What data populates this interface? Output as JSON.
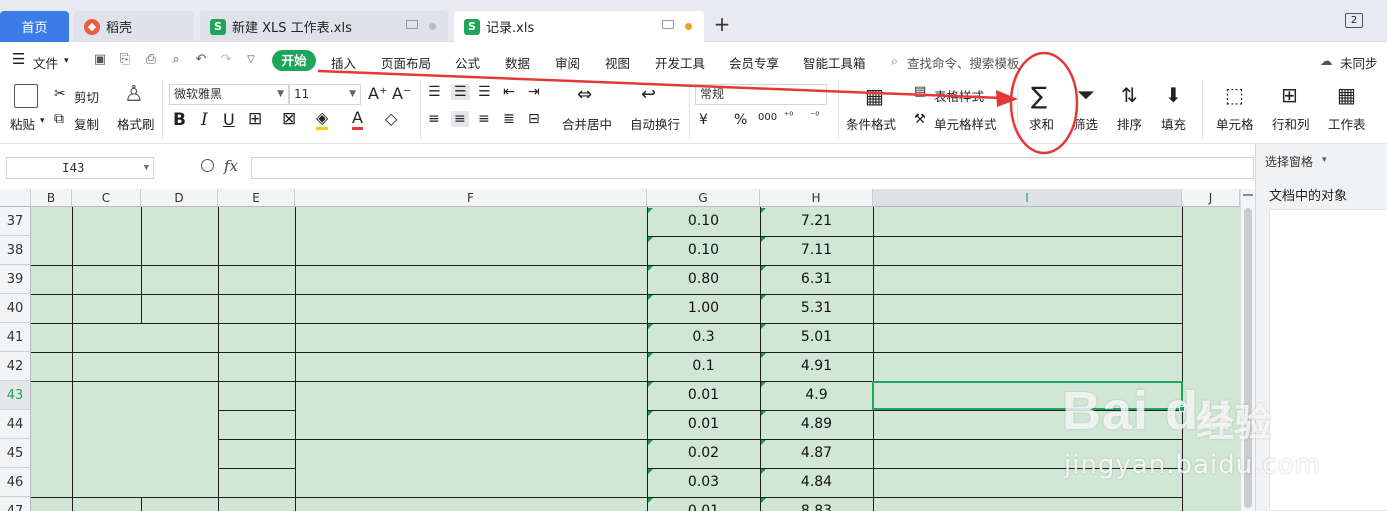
{
  "tabs": {
    "home": "首页",
    "daoke": "稻壳",
    "new_sheet": "新建 XLS 工作表.xls",
    "record": "记录.xls",
    "add": "+",
    "window_count": "2"
  },
  "menu": {
    "file": "文件",
    "start": "开始",
    "insert": "插入",
    "page_layout": "页面布局",
    "formula": "公式",
    "data": "数据",
    "review": "审阅",
    "view": "视图",
    "developer": "开发工具",
    "member": "会员专享",
    "smart_toolbox": "智能工具箱",
    "search": "查找命令、搜索模板",
    "sync": "未同步"
  },
  "ribbon": {
    "paste": "粘贴",
    "cut": "剪切",
    "copy": "复制",
    "format_painter": "格式刷",
    "font_name": "微软雅黑",
    "font_size": "11",
    "merge_center": "合并居中",
    "wrap_text": "自动换行",
    "number_format": "常规",
    "currency": "¥",
    "percent": "%",
    "thousands": "000",
    "cond_format": "条件格式",
    "table_style": "表格样式",
    "cell_style": "单元格样式",
    "sum": "求和",
    "filter": "筛选",
    "sort": "排序",
    "fill": "填充",
    "cell": "单元格",
    "row_col": "行和列",
    "worksheet": "工作表"
  },
  "formula_bar": {
    "name_box": "I43",
    "fx": "fx",
    "content": ""
  },
  "columns": [
    "B",
    "C",
    "D",
    "E",
    "F",
    "G",
    "H",
    "I",
    "J"
  ],
  "rows": [
    {
      "num": "37",
      "g": "0.10",
      "h": "7.21"
    },
    {
      "num": "38",
      "g": "0.10",
      "h": "7.11"
    },
    {
      "num": "39",
      "g": "0.80",
      "h": "6.31"
    },
    {
      "num": "40",
      "g": "1.00",
      "h": "5.31"
    },
    {
      "num": "41",
      "g": "0.3",
      "h": "5.01"
    },
    {
      "num": "42",
      "g": "0.1",
      "h": "4.91"
    },
    {
      "num": "43",
      "g": "0.01",
      "h": "4.9"
    },
    {
      "num": "44",
      "g": "0.01",
      "h": "4.89"
    },
    {
      "num": "45",
      "g": "0.02",
      "h": "4.87"
    },
    {
      "num": "46",
      "g": "0.03",
      "h": "4.84"
    },
    {
      "num": "47",
      "g": "0.01",
      "h": "8.83"
    }
  ],
  "side_panel": {
    "title": "选择窗格",
    "subtitle": "文档中的对象"
  },
  "watermark": {
    "logo": "Bai du",
    "jingyan": "经验",
    "url": "jingyan.baidu.com"
  },
  "colors": {
    "accent": "#1fa45b",
    "cell_fill": "#cfe7d4",
    "home_tab": "#3b7ce6",
    "annotation_red": "#e53935"
  }
}
